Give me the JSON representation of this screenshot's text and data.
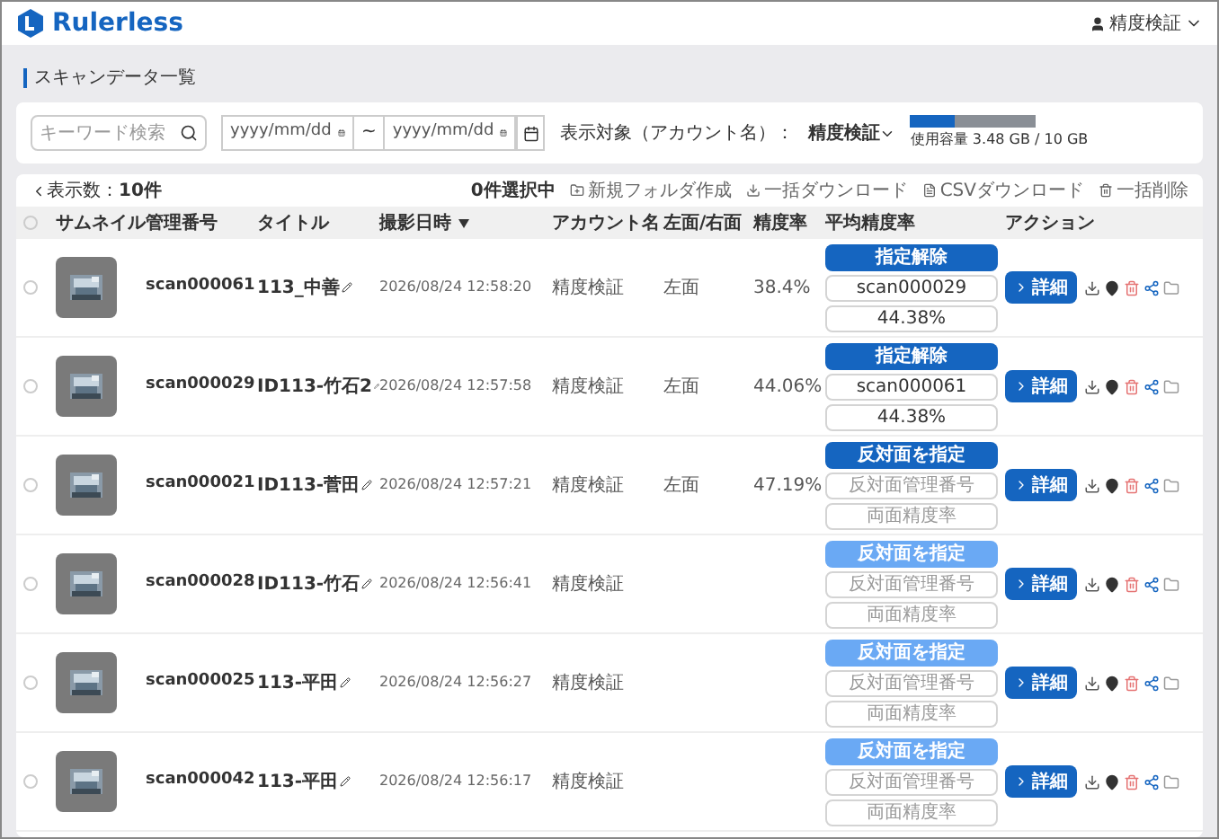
{
  "header": {
    "logo": "Rulerless",
    "user": "精度検証"
  },
  "breadcrumb": "スキャンデータ一覧",
  "filter": {
    "keyword_placeholder": "キーワード検索",
    "date_from_placeholder": "yyyy/mm/dd",
    "separator": "~",
    "date_to_placeholder": "yyyy/mm/dd",
    "target_label": "表示対象（アカウント名）：",
    "target_value": "精度検証",
    "storage": {
      "level": 0.348,
      "reading": "使用容量 3.48 GB / 10 GB"
    }
  },
  "toolbar": {
    "count_label": "表示数：",
    "count": "10件",
    "selected": "0件選択中",
    "actions": [
      {
        "kind": "folder",
        "label": "新規フォルダ作成"
      },
      {
        "kind": "download",
        "label": "一括ダウンロード"
      },
      {
        "kind": "csv",
        "label": "CSVダウンロード"
      },
      {
        "kind": "delete",
        "label": "一括削除"
      }
    ]
  },
  "table": {
    "all_checked": false,
    "columns": [
      "サムネイル",
      "管理番号",
      "タイトル",
      "撮影日時",
      "アカウント名",
      "左面/右面",
      "精度率",
      "平均精度率",
      "アクション"
    ],
    "rows": [
      {
        "checked": false,
        "id": "scan000061",
        "title": "113_中善",
        "date": "2026/08/24 12:58:20",
        "account": "精度検証",
        "side": "左面",
        "rate": "38.4%",
        "pair": {
          "kind": "designated",
          "button": "指定解除",
          "disabled": false,
          "pair_id": "scan000029",
          "pair_rate": "44.38%"
        },
        "detail": "詳細"
      },
      {
        "checked": false,
        "id": "scan000029",
        "title": "ID113-竹石2",
        "date": "2026/08/24 12:57:58",
        "account": "精度検証",
        "side": "左面",
        "rate": "44.06%",
        "pair": {
          "kind": "designated",
          "button": "指定解除",
          "disabled": false,
          "pair_id": "scan000061",
          "pair_rate": "44.38%"
        },
        "detail": "詳細"
      },
      {
        "checked": false,
        "id": "scan000021",
        "title": "ID113-菅田",
        "date": "2026/08/24 12:57:21",
        "account": "精度検証",
        "side": "左面",
        "rate": "47.19%",
        "pair": {
          "kind": "unset",
          "button": "反対面を指定",
          "disabled": false,
          "pair_id_placeholder": "反対面管理番号",
          "pair_rate_placeholder": "両面精度率"
        },
        "detail": "詳細"
      },
      {
        "checked": false,
        "id": "scan000028",
        "title": "ID113-竹石",
        "date": "2026/08/24 12:56:41",
        "account": "精度検証",
        "pair": {
          "kind": "unset",
          "button": "反対面を指定",
          "disabled": true,
          "pair_id_placeholder": "反対面管理番号",
          "pair_rate_placeholder": "両面精度率"
        },
        "detail": "詳細"
      },
      {
        "checked": false,
        "id": "scan000025",
        "title": "113-平田",
        "date": "2026/08/24 12:56:27",
        "account": "精度検証",
        "pair": {
          "kind": "unset",
          "button": "反対面を指定",
          "disabled": true,
          "pair_id_placeholder": "反対面管理番号",
          "pair_rate_placeholder": "両面精度率"
        },
        "detail": "詳細"
      },
      {
        "checked": false,
        "id": "scan000042",
        "title": "113-平田",
        "date": "2026/08/24 12:56:17",
        "account": "精度検証",
        "pair": {
          "kind": "unset",
          "button": "反対面を指定",
          "disabled": true,
          "pair_id_placeholder": "反対面管理番号",
          "pair_rate_placeholder": "両面精度率"
        },
        "detail": "詳細"
      }
    ]
  }
}
